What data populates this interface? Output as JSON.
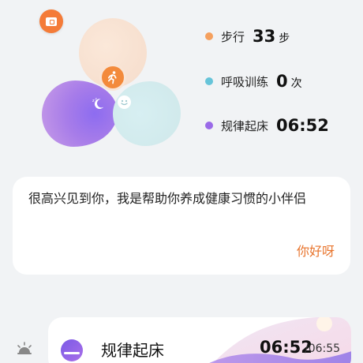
{
  "stats": [
    {
      "label": "步行",
      "value": "33",
      "unit": "步",
      "color": "#f5a05e"
    },
    {
      "label": "呼吸训练",
      "value": "0",
      "unit": "次",
      "color": "#66c4d9"
    },
    {
      "label": "规律起床",
      "value": "06:52",
      "unit": "",
      "color": "#9a6ae8"
    }
  ],
  "greeting_card": {
    "message": "很高兴见到你，我是帮助你养成健康习惯的小伴侣",
    "action": "你好呀"
  },
  "habit_card": {
    "title": "规律起床",
    "time": "06:52",
    "target": "/06:55"
  },
  "icons": {
    "badge": "ticket-icon",
    "walk": "running-icon",
    "sleep": "moon-sleep-icon",
    "breath": "smile-icon",
    "alarm": "alarm-icon",
    "wake": "sunrise-icon"
  },
  "colors": {
    "accent": "#e8742c",
    "walk": "#f38a3b",
    "sleep": "#9a6ae8",
    "breath": "#66c4d9"
  }
}
